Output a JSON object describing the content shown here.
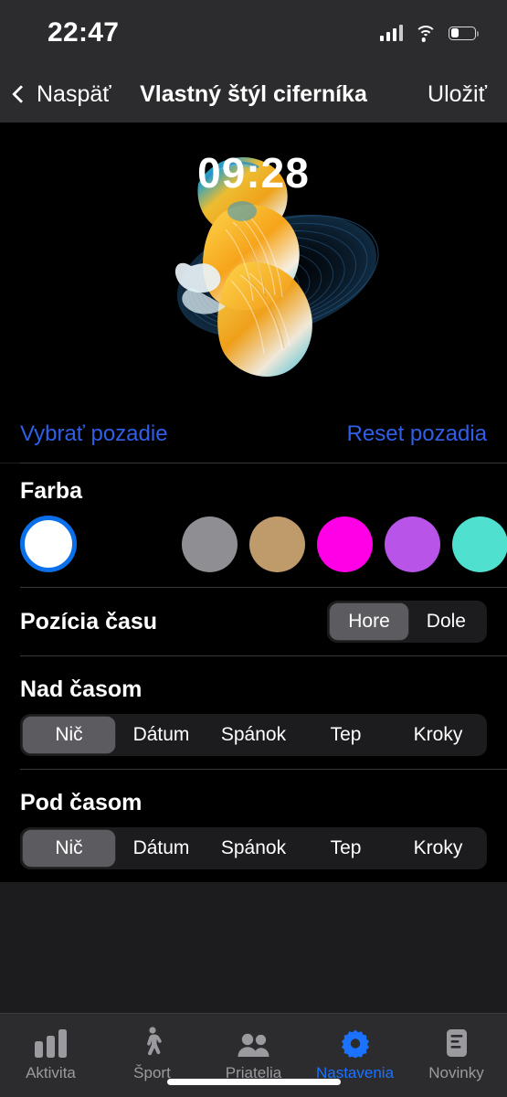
{
  "status_bar": {
    "time": "22:47",
    "signal_icon": "cellular-signal-icon",
    "wifi_icon": "wifi-icon",
    "battery_icon": "battery-icon",
    "battery_level_percent": 30
  },
  "nav_bar": {
    "back_label": "Naspäť",
    "back_icon": "chevron-left-icon",
    "title": "Vlastný štýl ciferníka",
    "save_label": "Uložiť"
  },
  "preview": {
    "time": "09:28",
    "wallpaper": "betta-fish-wallpaper"
  },
  "background_actions": {
    "choose_label": "Vybrať pozadie",
    "reset_label": "Reset pozadia",
    "link_color": "#2f5fe8"
  },
  "color_section": {
    "title": "Farba",
    "selected_index": 0,
    "selection_ring_color": "#0a6fe8",
    "swatches": [
      {
        "name": "white",
        "hex": "#ffffff"
      },
      {
        "name": "gray",
        "hex": "#8e8e93"
      },
      {
        "name": "tan",
        "hex": "#bf9a6a"
      },
      {
        "name": "magenta",
        "hex": "#ff00e6"
      },
      {
        "name": "purple",
        "hex": "#b954e8"
      },
      {
        "name": "turquoise",
        "hex": "#4fe0cf"
      },
      {
        "name": "cyan",
        "hex": "#3bc8ee"
      }
    ]
  },
  "time_position": {
    "label": "Pozícia času",
    "options": [
      "Hore",
      "Dole"
    ],
    "selected": "Hore"
  },
  "above_time": {
    "label": "Nad časom",
    "options": [
      "Nič",
      "Dátum",
      "Spánok",
      "Tep",
      "Kroky"
    ],
    "selected": "Nič"
  },
  "below_time": {
    "label": "Pod časom",
    "options": [
      "Nič",
      "Dátum",
      "Spánok",
      "Tep",
      "Kroky"
    ],
    "selected": "Nič"
  },
  "tab_bar": {
    "active_index": 3,
    "active_color": "#1a72ff",
    "inactive_color": "#9a9a9f",
    "tabs": [
      {
        "label": "Aktivita",
        "icon": "bar-chart-icon"
      },
      {
        "label": "Šport",
        "icon": "walking-person-icon"
      },
      {
        "label": "Priatelia",
        "icon": "people-icon"
      },
      {
        "label": "Nastavenia",
        "icon": "gear-icon"
      },
      {
        "label": "Novinky",
        "icon": "document-icon"
      }
    ]
  }
}
